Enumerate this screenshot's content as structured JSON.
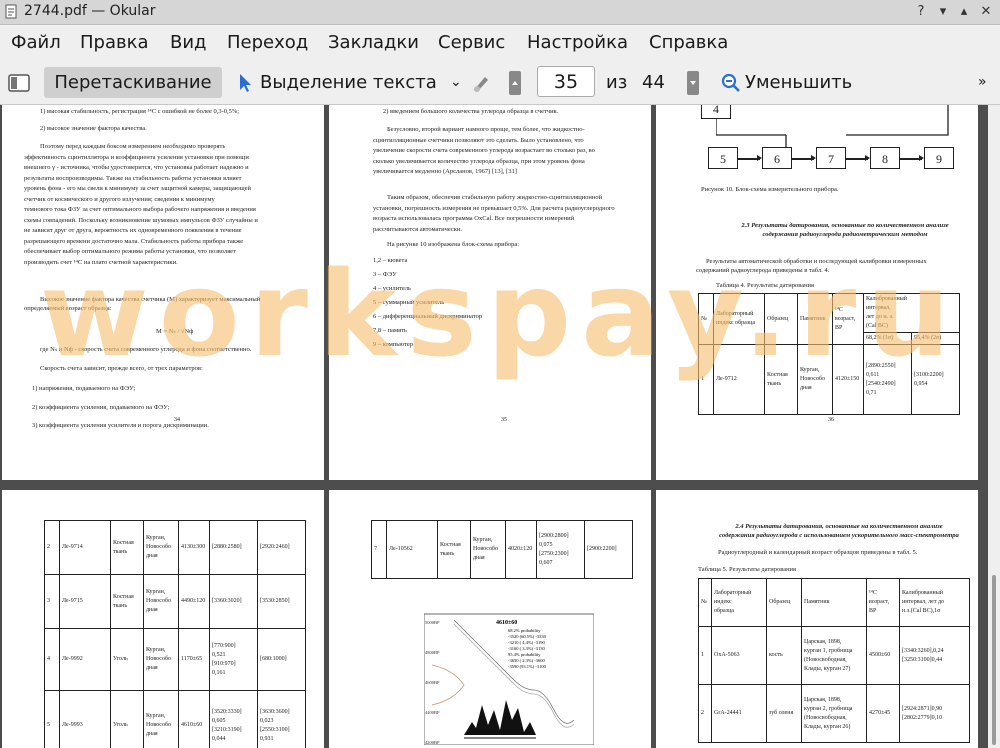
{
  "window": {
    "title": "2744.pdf — Okular"
  },
  "menu": [
    "Файл",
    "Правка",
    "Вид",
    "Переход",
    "Закладки",
    "Сервис",
    "Настройка",
    "Справка"
  ],
  "toolbar": {
    "drag": "Перетаскивание",
    "select": "Выделение текста",
    "page_current": "35",
    "page_of": "из",
    "page_total": "44",
    "zoom_out": "Уменьшить"
  },
  "watermark": "workspay.ru",
  "page34": {
    "l1": "1) высокая стабильность, регистрация ¹⁴С с ошибкой не более 0,3-0,5%;",
    "l2": "2) высокое значение фактора качества.",
    "p1": [
      "Поэтому перед каждым боксом измерением необходимо проверять",
      "эффективность сцинтиллятора и коэффициента усиления установки при помощи",
      "внешнего γ - источника, чтобы удостоверится, что установка работает надежно и",
      "результаты воспроизводимы. Также на стабильность работы установки влияет",
      "уровень фона - его мы свели к минимуму за счет защитной камеры, защищающей",
      "счетчик от космического и другого излучения; сведения к минимуму",
      "темнового тока ФЗУ за счет оптимального выбора рабочего напряжения и введения",
      "схемы совпадений. Поскольку возникновение шумовых импульсов ФЗУ случайны и",
      "не зависят друг от друга, вероятность их одновременного появления в течение",
      "разрешающего времени достаточно мала. Стабильность работы прибора также",
      "обеспечивает выбор оптимального режима работы установки, что позволяет",
      "производить счет ¹⁴С на плато счетной характеристики."
    ],
    "p2": [
      "Высокое значение фактора качества счетчика (М) характеризует максимальный",
      "определяемый возраст образца:"
    ],
    "formula": "M = Nₛ / √Nф",
    "p3": "где Nₛ и Nф - скорость счета современного углерода и фона соответственно.",
    "p4": "Скорость счета зависит, прежде всего, от трех параметров:",
    "items": [
      "1)  напряжения, подаваемого на ФЭУ;",
      "2)  коэффициента усиления, подаваемого на ФЭУ;",
      "3)  коэффициента усиления усилителя и порога дискриминации."
    ],
    "num": "34"
  },
  "page35": {
    "l1": "2)  введением большого количества углерода образца в счетчик.",
    "p1": [
      "Безусловно, второй вариант намного проще, тем более, что жидкостно-",
      "сцинтилляционные счетчики позволяют это сделать. Было установлено, что",
      "увеличение скорости счета современного углерода возрастает во столько раз, во",
      "сколько увеличивается количество углерода образца, при этом уровень фона",
      "увеличивается медленно (Арсланов, 1967) [13], [31]"
    ],
    "p2": [
      "Таким образом, обеспечив стабильную работу жидкостно-сцинтилляционной",
      "установки, погрешность измерения не превышает 0,5%. Для расчета радиоуглеродного",
      "возраста использовалась программа OxCal. Все погрешности измерений",
      "рассчитываются автоматически."
    ],
    "p3": "На рисунке 10 изображена блок-схема прибора:",
    "items": [
      "1,2 – кювета",
      "3 – ФЭУ",
      "4 – усилитель",
      "5 – суммарный усилитель",
      "6 – дифференциальный дискриминатор",
      "7,8 – память",
      "9 – компьютер"
    ],
    "num": "35"
  },
  "page36": {
    "boxes": [
      "4",
      "5",
      "6",
      "7",
      "8",
      "9"
    ],
    "caption": "Рисунок 10. Блок-схема измерительного прибора.",
    "heading": [
      "2.3 Результаты датирования, основанные по количественном анализе",
      "содержания радиоуглерода радиометрическим методом"
    ],
    "p1": [
      "Результаты автоматической обработки и последующей калибровки измеренных",
      "содержаний радиоуглерода приведены в табл. 4."
    ],
    "tcap": "Таблица 4. Результаты датирования",
    "th": {
      "n": "№",
      "lab": [
        "Лабораторный",
        "индекс образца"
      ],
      "obr": "Образец",
      "pam": "Памятник",
      "c14": [
        "¹⁴С",
        "возраст,",
        "BP"
      ],
      "cal": [
        "Калиброванный",
        "интервал,",
        "лет до н. э.",
        "(Cal BC)"
      ],
      "p1": "68,2% (1σ)",
      "p2": "95,4% (2σ)"
    },
    "row": {
      "n": "1",
      "lab": "Ле-9712",
      "obr": [
        "Костная",
        "ткань"
      ],
      "pam": [
        "Курган,",
        "Новособо",
        "дная"
      ],
      "age": "4120±150",
      "c1": [
        "[2890:2550]",
        "0,611",
        "[2540:2490]",
        "0,71"
      ],
      "c2": [
        "[3100:2200]",
        "0,954"
      ]
    },
    "num": "36"
  },
  "page37": {
    "rows": [
      {
        "n": "2",
        "lab": "Ле-9714",
        "obr": [
          "Костная",
          "ткань"
        ],
        "pam": [
          "Курган,",
          "Новособо",
          "дная"
        ],
        "age": "4130±300",
        "c1": [
          "[2880:2580]"
        ],
        "c2": [
          "[2920:2460]"
        ]
      },
      {
        "n": "3",
        "lab": "Ле-9715",
        "obr": [
          "Костная",
          "ткань"
        ],
        "pam": [
          "Курган,",
          "Новособо",
          "дная"
        ],
        "age": "4490±120",
        "c1": [
          "[3360:3020]"
        ],
        "c2": [
          "[3530:2850]"
        ]
      },
      {
        "n": "4",
        "lab": "Ле-9992",
        "obr": [
          "Уголь"
        ],
        "pam": [
          "Курган,",
          "Новособо",
          "дная"
        ],
        "age": "1170±65",
        "c1": [
          "[770:900]",
          "0,521",
          "[910:970]",
          "0,161"
        ],
        "c2": [
          "[680:1000]"
        ]
      },
      {
        "n": "5",
        "lab": "Ле-9993",
        "obr": [
          "Уголь"
        ],
        "pam": [
          "Курган,",
          "Новособо",
          "дная"
        ],
        "age": "4610±60",
        "c1": [
          "[3520:3330]",
          "0,605",
          "[3210:3190]",
          "0,044"
        ],
        "c2": [
          "[3630:3600]",
          "0,023",
          "[2550:3100]",
          "0,931"
        ]
      }
    ]
  },
  "page38": {
    "row": {
      "n": "7",
      "lab": "Ле-10562",
      "obr": [
        "Костная",
        "ткань"
      ],
      "pam": [
        "Курган,",
        "Новособо",
        "дная"
      ],
      "age": "4020±120",
      "c1": [
        "[2900:2800]",
        "0,075",
        "[2750:2300]",
        "0,607"
      ],
      "c2": [
        "[2900:2200]"
      ]
    },
    "plot": {
      "title": "4610±60",
      "legend": [
        "68.2% probability",
        "-3520 (60.5%) -3330",
        "-3210 ( 4.4%) -3190",
        "-3160 ( 3.3%) -3130",
        "95.4% probability",
        "-3650 ( 2.3%) -3600",
        "-3590 (93.1%) -3100"
      ],
      "yticks": [
        "5000BP",
        "4800BP",
        "4600BP",
        "4400BP",
        "4200BP"
      ]
    }
  },
  "page39": {
    "heading": [
      "2.4 Результаты датирования, основанные на количественном анализе",
      "содержания радиоуглерода с использованием ускорительного масс-спектрометра"
    ],
    "p1": "Радиоуглеродный и календарный возраст образцов приведены в табл. 5.",
    "tcap": "Таблица 5. Результаты датирования",
    "th": {
      "n": "№",
      "lab": [
        "Лабораторный",
        "индекс",
        "образца"
      ],
      "obr": "Образец",
      "pam": "Памятник",
      "c14": [
        "¹⁴С",
        "возраст,",
        "ВР"
      ],
      "cal": [
        "Калиброванный",
        "интервал, лет до",
        "н.э.(Cal BC),1σ"
      ]
    },
    "rows": [
      {
        "n": "1",
        "lab": "OxA-5063",
        "obr": "кость",
        "pam": [
          "Царская, 1898,",
          "курган 1, гробница",
          "(Новосвободная,",
          "Клады, курган 27)"
        ],
        "age": "4500±60",
        "cal": [
          "[3340:3260],0,24",
          "[3250:3100]0,44"
        ]
      },
      {
        "n": "2",
        "lab": "GrA-24441",
        "obr": "зуб оленя",
        "pam": [
          "Царская, 1898,",
          "курган 2, гробница",
          "(Новосвободная,",
          "Клады, курган 26)"
        ],
        "age": "4270±45",
        "cal": [
          "[2924:2871]0,90",
          "[2802:2779]0,10"
        ]
      }
    ]
  }
}
